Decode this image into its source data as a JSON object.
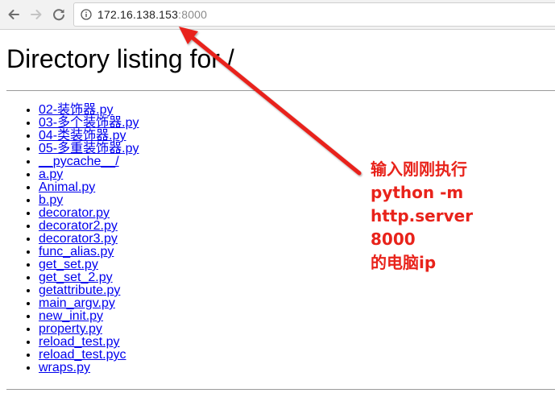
{
  "browser": {
    "url_host": "172.16.138.153",
    "url_port": ":8000",
    "icons": {
      "back": "arrow-left-icon",
      "forward": "arrow-right-icon",
      "reload": "reload-icon",
      "info": "info-icon"
    }
  },
  "page": {
    "title": "Directory listing for /",
    "files": [
      "02-装饰器.py",
      "03-多个装饰器.py",
      "04-类装饰器.py",
      "05-多重装饰器.py",
      "__pycache__/",
      "a.py",
      "Animal.py",
      "b.py",
      "decorator.py",
      "decorator2.py",
      "decorator3.py",
      "func_alias.py",
      "get_set.py",
      "get_set_2.py",
      "getattribute.py",
      "main_argv.py",
      "new_init.py",
      "property.py",
      "reload_test.py",
      "reload_test.pyc",
      "wraps.py"
    ]
  },
  "annotation": {
    "lines": [
      "输入刚刚执行",
      "python -m",
      "http.server",
      "8000",
      "的电脑ip"
    ],
    "color": "#e8231b"
  }
}
